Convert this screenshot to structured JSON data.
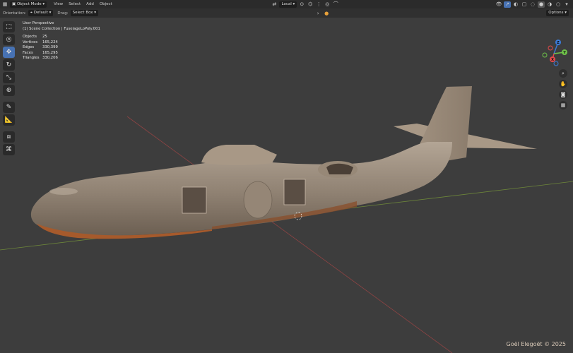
{
  "header": {
    "mode": "Object Mode",
    "menus": [
      "View",
      "Select",
      "Add",
      "Object"
    ],
    "transform_orientation": "Local",
    "options_label": "Options"
  },
  "toolsettings": {
    "orientation_label": "Orientation:",
    "orientation_value": "Default",
    "drag_label": "Drag:",
    "drag_value": "Select Box"
  },
  "overlay": {
    "perspective": "User Perspective",
    "collection": "(1) Scene Collection | FuselageLoPoly.001",
    "stats": [
      {
        "label": "Objects",
        "value": "25"
      },
      {
        "label": "Vertices",
        "value": "165,224"
      },
      {
        "label": "Edges",
        "value": "330,399"
      },
      {
        "label": "Faces",
        "value": "165,295"
      },
      {
        "label": "Triangles",
        "value": "330,206"
      }
    ]
  },
  "gizmo": {
    "x": "X",
    "y": "Y",
    "z": "Z"
  },
  "watermark": "Goël Elegoët © 2025",
  "icons": [
    "select-box-icon",
    "cursor-icon",
    "move-icon",
    "rotate-icon",
    "scale-icon",
    "transform-icon",
    "annotate-icon",
    "measure-icon",
    "add-cube-icon",
    "origin-icon",
    "zoom-icon",
    "hand-icon",
    "camera-icon",
    "grid-icon"
  ],
  "colors": {
    "accent": "#4772b3",
    "axis_x": "#e64a4a",
    "axis_y": "#6fc34a",
    "axis_z": "#3b7bd8",
    "model": "#9c8c7c",
    "underside": "#a65a2c"
  }
}
